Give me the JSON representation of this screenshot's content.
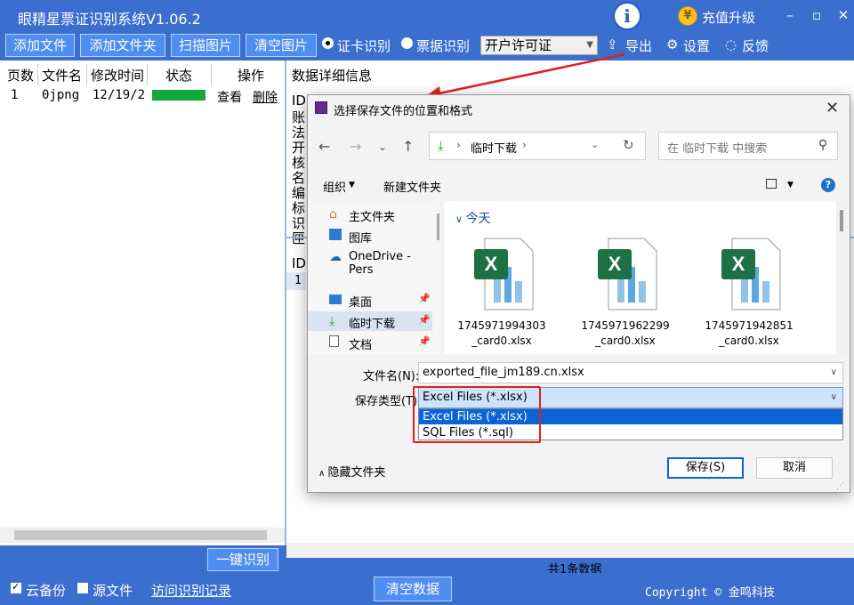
{
  "app": {
    "title": "眼精星票证识别系统V1.06.2",
    "upgrade_label": "充值升级",
    "coin_glyph": "¥"
  },
  "toolbar": {
    "add_file": "添加文件",
    "add_folder": "添加文件夹",
    "scan_image": "扫描图片",
    "clear_images": "清空图片",
    "radio_card": "证卡识别",
    "radio_ticket": "票据识别",
    "combo_value": "开户许可证",
    "export": "导出",
    "settings": "设置",
    "feedback": "反馈"
  },
  "table": {
    "headers": [
      "页数",
      "文件名",
      "修改时间",
      "状态",
      "操作"
    ],
    "row": {
      "page": "1",
      "filename": "0jpng",
      "modified": "12/19/2",
      "progress": 100,
      "view": "查看",
      "delete": "删除"
    }
  },
  "detail": {
    "title": "数据详细信息",
    "lines": [
      "ID",
      "账",
      "法",
      "开",
      "核",
      "名",
      "编",
      "标",
      "识",
      "匣"
    ],
    "lower_lines": [
      "ID",
      "1"
    ]
  },
  "bottom": {
    "one_click": "一键识别",
    "count_label": "共1条数据",
    "cloud_backup": "云备份",
    "source_file": "源文件",
    "history_link": "访问识别记录",
    "clear_data": "清空数据",
    "copyright": "Copyright © 金鸣科技"
  },
  "dialog": {
    "title": "选择保存文件的位置和格式",
    "address": "临时下载",
    "search_placeholder": "在 临时下载 中搜索",
    "organize": "组织",
    "new_folder": "新建文件夹",
    "nav_items": [
      {
        "label": "主文件夹",
        "icon": "home-icon"
      },
      {
        "label": "图库",
        "icon": "gallery-icon"
      },
      {
        "label": "OneDrive - Pers",
        "icon": "cloud-icon"
      },
      {
        "label": "桌面",
        "icon": "desktop-icon",
        "pinned": true
      },
      {
        "label": "临时下载",
        "icon": "download-icon",
        "pinned": true,
        "selected": true
      },
      {
        "label": "文档",
        "icon": "document-icon",
        "pinned": true
      }
    ],
    "group_header": "今天",
    "files": [
      {
        "name_line1": "1745971994303",
        "name_line2": "_card0.xlsx"
      },
      {
        "name_line1": "1745971962299",
        "name_line2": "_card0.xlsx"
      },
      {
        "name_line1": "1745971942851",
        "name_line2": "_card0.xlsx"
      }
    ],
    "filename_label": "文件名(N):",
    "filename_value": "exported_file_jm189.cn.xlsx",
    "type_label": "保存类型(T)",
    "type_value": "Excel Files (*.xlsx)",
    "type_options": [
      "Excel Files (*.xlsx)",
      "SQL Files (*.sql)"
    ],
    "hide_folders": "隐藏文件夹",
    "save": "保存(S)",
    "cancel": "取消"
  },
  "colors": {
    "app_blue": "#3a6fcf",
    "button_blue": "#4f8ef0",
    "progress_green": "#13a83a",
    "highlight_red": "#e02020",
    "selection_blue": "#0a64d8"
  }
}
